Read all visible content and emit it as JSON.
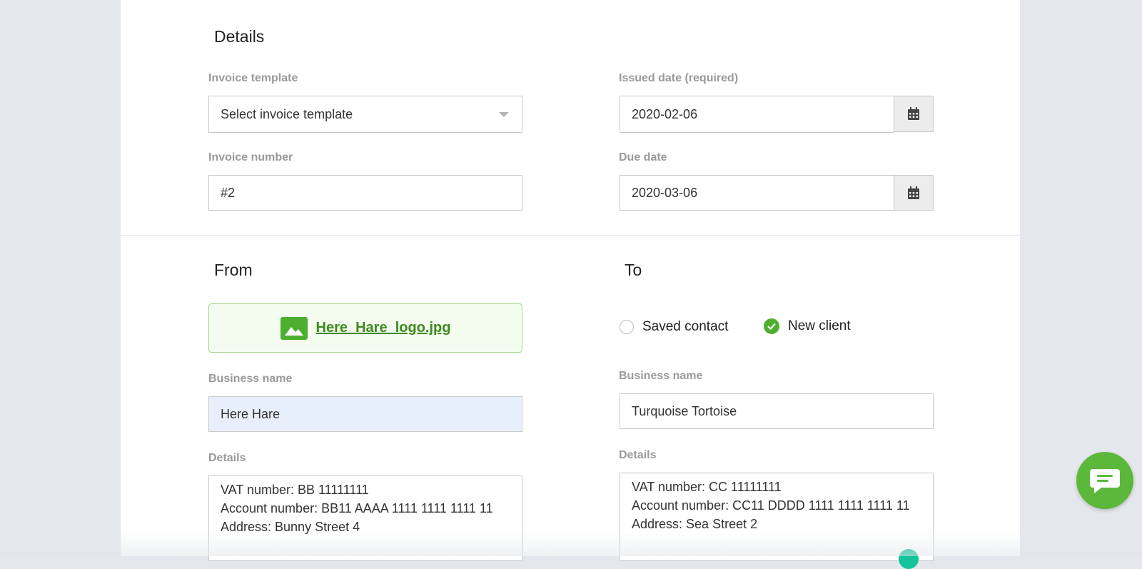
{
  "details": {
    "title": "Details",
    "invoice_template": {
      "label": "Invoice template",
      "value": "Select invoice template"
    },
    "issued_date": {
      "label": "Issued date (required)",
      "value": "2020-02-06"
    },
    "invoice_number": {
      "label": "Invoice number",
      "value": "#2"
    },
    "due_date": {
      "label": "Due date",
      "value": "2020-03-06"
    }
  },
  "from": {
    "title": "From",
    "logo_file": "Here_Hare_logo.jpg",
    "business_name": {
      "label": "Business name",
      "value": "Here Hare"
    },
    "details": {
      "label": "Details",
      "lines": [
        "VAT number: BB 11111111",
        "Account number: BB11 AAAA 1111 1111 1111 11",
        "Address: Bunny Street 4"
      ]
    }
  },
  "to": {
    "title": "To",
    "options": [
      {
        "label": "Saved contact",
        "selected": false
      },
      {
        "label": "New client",
        "selected": true
      }
    ],
    "business_name": {
      "label": "Business name",
      "value": "Turquoise Tortoise"
    },
    "details": {
      "label": "Details",
      "lines": [
        "VAT number: CC 11111111",
        "Account number: CC11 DDDD 1111 1111 1111 11",
        "Address: Sea Street 2"
      ]
    }
  },
  "colors": {
    "accent": "#4caf2f",
    "link": "#3d8a1e",
    "autofill": "#e8effc"
  },
  "icons": [
    "calendar-icon",
    "image-icon",
    "check-icon",
    "chat-icon",
    "chevron-down-icon"
  ]
}
